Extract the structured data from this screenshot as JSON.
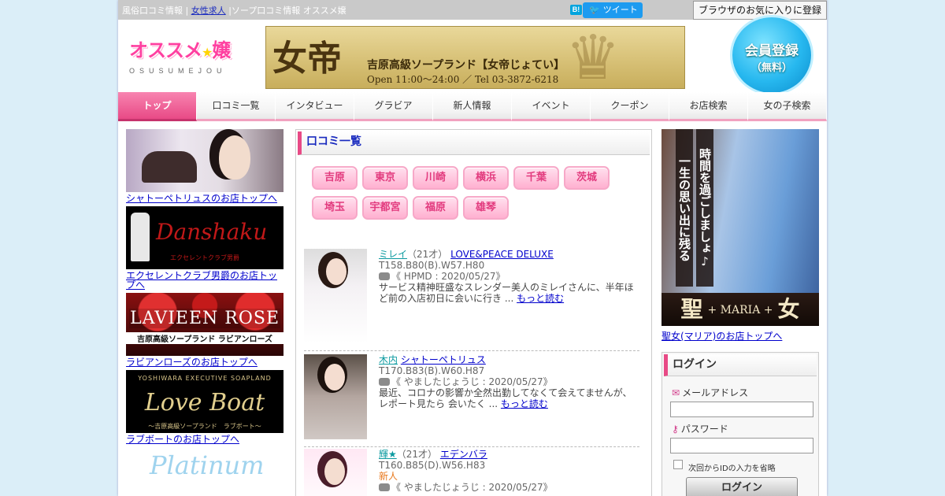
{
  "topbar": {
    "crumb1": "風俗口コミ情報",
    "sep1": " | ",
    "crumb2": "女性求人",
    "sep2": " |ソープ口コミ情報 オススメ嬢",
    "hatena": "B!",
    "tweet": "ツイート",
    "favorite": "ブラウザのお気に入りに登録"
  },
  "header": {
    "logo_main_1": "オススメ",
    "logo_star": "★",
    "logo_main_2": "嬢",
    "logo_sub": "OSUSUMEJOU",
    "banner_kanji": "女帝",
    "banner_line1": "吉原高級ソープランド【女帝じょてい】",
    "banner_line2": "Open 11:00～24:00 ／ Tel 03-3872-6218",
    "member_line1": "会員登録",
    "member_line2": "（無料）"
  },
  "nav": [
    {
      "label": "トップ",
      "active": true
    },
    {
      "label": "口コミ一覧"
    },
    {
      "label": "インタビュー"
    },
    {
      "label": "グラビア"
    },
    {
      "label": "新人情報"
    },
    {
      "label": "イベント"
    },
    {
      "label": "クーポン"
    },
    {
      "label": "お店検索"
    },
    {
      "label": "女の子検索"
    }
  ],
  "left_shops": [
    {
      "caption": "シャトーペトリュスのお店トップへ"
    },
    {
      "caption": "エクセレントクラブ男爵のお店トップへ",
      "logo": "Danshaku",
      "logo_sub": "エクセレントクラブ男爵"
    },
    {
      "caption": "ラビアンローズのお店トップへ",
      "logo": "LAVIEEN ROSE",
      "logo_sub": "吉原高級ソープランド ラビアンローズ"
    },
    {
      "caption": "ラブボートのお店トップへ",
      "logo_top": "YOSHIWARA EXECUTIVE SOAPLAND",
      "logo": "Love Boat",
      "logo_sub": "～吉原高級ソープランド　ラブボート～"
    },
    {
      "logo": "Platinum"
    }
  ],
  "reviews_section": {
    "title": "口コミ一覧",
    "areas": [
      "吉原",
      "東京",
      "川崎",
      "横浜",
      "千葉",
      "茨城",
      "埼玉",
      "宇都宮",
      "福原",
      "雄琴"
    ]
  },
  "reviews": [
    {
      "name": "ミレイ",
      "age": "（21才）",
      "shop": "LOVE&PEACE DELUXE",
      "size": "T158.B80(B).W57.H80",
      "meta": "《 HPMD : 2020/05/27》",
      "text": "サービス精神旺盛なスレンダー美人のミレイさんに、半年ほど前の入店初日に会いに行き ...",
      "more": "もっと読む"
    },
    {
      "name": "木内",
      "age": "",
      "shop": "シャトーペトリュス",
      "size": "T170.B83(B).W60.H87",
      "meta": "《 やましたじょうじ : 2020/05/27》",
      "text": "最近、コロナの影響か全然出勤してなくて会えてませんが、レポート見たら 会いたく ...",
      "more": "もっと読む"
    },
    {
      "name": "輝★",
      "age": "（21才）",
      "shop": "エデンバラ",
      "size": "T160.B85(D).W56.H83",
      "badge": "新人",
      "meta": "《 やましたじょうじ : 2020/05/27》"
    }
  ],
  "right": {
    "ad_strip1": "一生の思い出に残る",
    "ad_strip2": "時間を過ごしましょ♪",
    "ad_bottom_left": "聖",
    "ad_bottom_mid": "+ MARIA +",
    "ad_bottom_right": "女",
    "caption": "聖女(マリア)のお店トップへ"
  },
  "login": {
    "title": "ログイン",
    "email_label": "メールアドレス",
    "password_label": "パスワード",
    "remember_label": "次回からIDの入力を省略",
    "button": "ログイン"
  }
}
